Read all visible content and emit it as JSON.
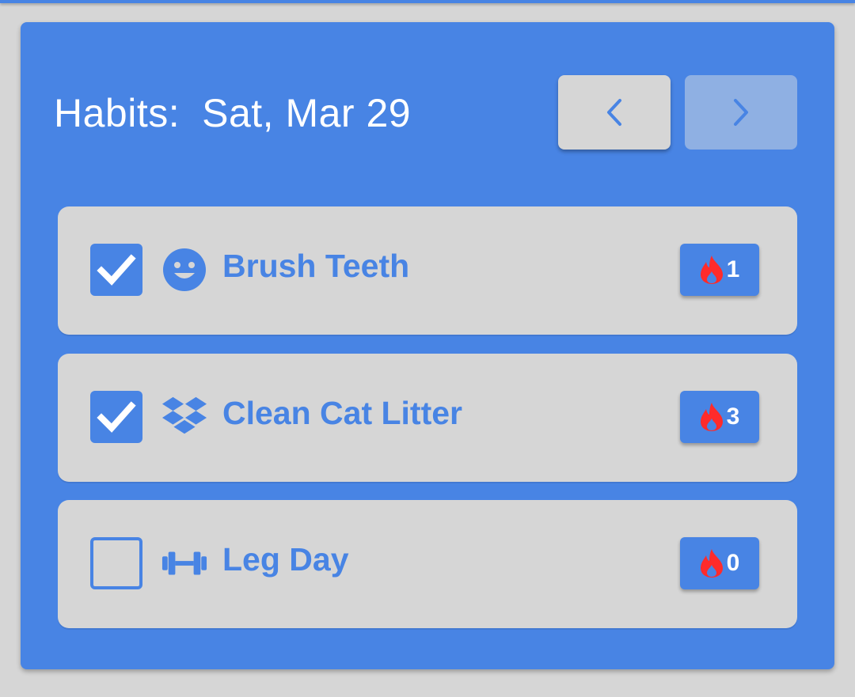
{
  "header": {
    "title": "Habits:",
    "date": "Sat, Mar 29",
    "prev_icon": "chevron-left-icon",
    "next_icon": "chevron-right-icon",
    "next_disabled": true
  },
  "habits": [
    {
      "label": "Brush Teeth",
      "checked": true,
      "icon": "smile-icon",
      "streak": "1"
    },
    {
      "label": "Clean Cat Litter",
      "checked": true,
      "icon": "dropbox-icon",
      "streak": "3"
    },
    {
      "label": "Leg Day",
      "checked": false,
      "icon": "dumbbell-icon",
      "streak": "0"
    }
  ],
  "colors": {
    "accent": "#4884e4",
    "surface": "#d6d6d6",
    "flame": "#ff2b2b"
  }
}
